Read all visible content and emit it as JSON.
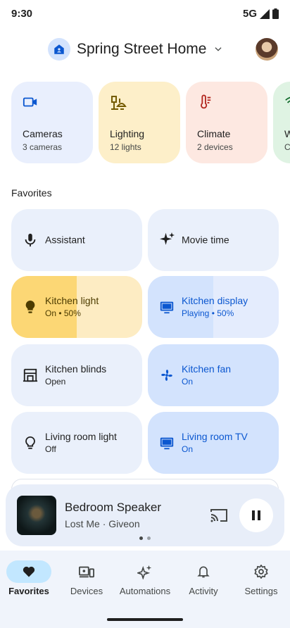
{
  "status": {
    "time": "9:30",
    "network": "5G"
  },
  "header": {
    "home_name": "Spring Street Home"
  },
  "categories": [
    {
      "title": "Cameras",
      "subtitle": "3 cameras",
      "icon": "video-camera-icon",
      "bg": "#e9effd",
      "icon_color": "#0b57d0"
    },
    {
      "title": "Lighting",
      "subtitle": "12 lights",
      "icon": "lamp-icon",
      "bg": "#fdefc9",
      "icon_color": "#745b00"
    },
    {
      "title": "Climate",
      "subtitle": "2 devices",
      "icon": "thermometer-icon",
      "bg": "#fde8e1",
      "icon_color": "#b3261e"
    },
    {
      "title": "W",
      "subtitle": "C",
      "icon": "wifi-icon",
      "bg": "#dff3e3",
      "icon_color": "#146c2e"
    }
  ],
  "favorites": {
    "title": "Favorites",
    "tiles": [
      {
        "title": "Assistant",
        "subtitle": "",
        "icon": "microphone-icon",
        "style": "plain"
      },
      {
        "title": "Movie time",
        "subtitle": "",
        "icon": "sparkle-icon",
        "style": "plain"
      },
      {
        "title": "Kitchen light",
        "subtitle": "On • 50%",
        "icon": "bulb-icon",
        "style": "yellow",
        "level": 0.5
      },
      {
        "title": "Kitchen display",
        "subtitle": "Playing • 50%",
        "icon": "display-icon",
        "style": "blue",
        "level": 0.5
      },
      {
        "title": "Kitchen blinds",
        "subtitle": "Open",
        "icon": "blinds-icon",
        "style": "plain"
      },
      {
        "title": "Kitchen fan",
        "subtitle": "On",
        "icon": "fan-icon",
        "style": "blue"
      },
      {
        "title": "Living room light",
        "subtitle": "Off",
        "icon": "bulb-outline-icon",
        "style": "plain"
      },
      {
        "title": "Living room TV",
        "subtitle": "On",
        "icon": "tv-icon",
        "style": "blue"
      }
    ]
  },
  "player": {
    "title": "Bedroom Speaker",
    "subtitle": "Lost Me · Giveon",
    "page": 1,
    "pages": 2
  },
  "nav": [
    {
      "label": "Favorites",
      "icon": "heart-icon",
      "active": true
    },
    {
      "label": "Devices",
      "icon": "devices-icon",
      "active": false
    },
    {
      "label": "Automations",
      "icon": "automations-icon",
      "active": false
    },
    {
      "label": "Activity",
      "icon": "bell-icon",
      "active": false
    },
    {
      "label": "Settings",
      "icon": "gear-icon",
      "active": false
    }
  ],
  "colors": {
    "accent": "#0b57d0",
    "tile_bg": "#eaf0fb",
    "tile_blue": "#d3e3fd",
    "yellow_on": "#fcd775",
    "yellow_off": "#fdecc3"
  }
}
